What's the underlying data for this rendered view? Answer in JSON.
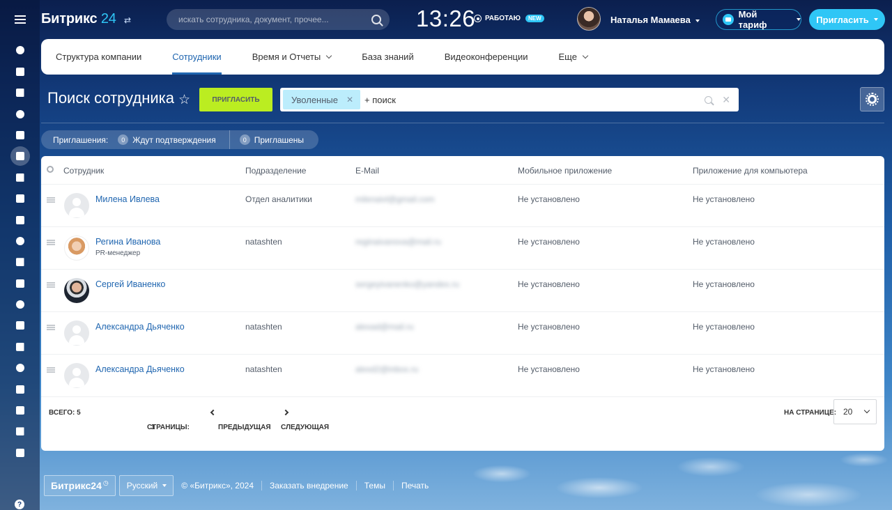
{
  "topbar": {
    "logo_main": "Битрикс",
    "logo_num": "24",
    "search_placeholder": "искать сотрудника, документ, прочее...",
    "time": "13:26",
    "work_status": "РАБОТАЮ",
    "new_badge": "NEW",
    "user_name": "Наталья Мамаева",
    "tariff_label": "Мой тариф",
    "invite_label": "Пригласить"
  },
  "nav": {
    "items": [
      {
        "label": "Структура компании"
      },
      {
        "label": "Сотрудники"
      },
      {
        "label": "Время и Отчеты"
      },
      {
        "label": "База знаний"
      },
      {
        "label": "Видеоконференции"
      },
      {
        "label": "Еще"
      }
    ]
  },
  "page": {
    "title": "Поиск сотрудника",
    "invite_button": "ПРИГЛАСИТЬ",
    "filter_chip": "Уволенные",
    "filter_add": "+ поиск"
  },
  "invitations": {
    "label": "Приглашения:",
    "pending_count": "0",
    "pending_label": "Ждут подтверждения",
    "invited_count": "0",
    "invited_label": "Приглашены"
  },
  "grid": {
    "columns": [
      "Сотрудник",
      "Подразделение",
      "E-Mail",
      "Мобильное приложение",
      "Приложение для компьютера"
    ],
    "rows": [
      {
        "name": "Милена Ивлева",
        "position": "",
        "department": "Отдел аналитики",
        "email": "milenaivl@gmail.com",
        "mobile": "Не установлено",
        "desktop": "Не установлено",
        "avatar": "blank"
      },
      {
        "name": "Регина Иванова",
        "position": "PR-менеджер",
        "department": "natashten",
        "email": "reginaivanova@mail.ru",
        "mobile": "Не установлено",
        "desktop": "Не установлено",
        "avatar": "photo1"
      },
      {
        "name": "Сергей Иваненко",
        "position": "",
        "department": "",
        "email": "sergeyivanenko@yandex.ru",
        "mobile": "Не установлено",
        "desktop": "Не установлено",
        "avatar": "photo2"
      },
      {
        "name": "Александра Дьяченко",
        "position": "",
        "department": "natashten",
        "email": "alexad@mail.ru",
        "mobile": "Не установлено",
        "desktop": "Не установлено",
        "avatar": "blank"
      },
      {
        "name": "Александра Дьяченко",
        "position": "",
        "department": "natashten",
        "email": "alexd2@inbox.ru",
        "mobile": "Не установлено",
        "desktop": "Не установлено",
        "avatar": "blank"
      }
    ],
    "total_label": "ВСЕГО: 5",
    "pages_label": "СТРАНИЦЫ:",
    "pages_value": "1",
    "prev_label": "ПРЕДЫДУЩАЯ",
    "next_label": "СЛЕДУЮЩАЯ",
    "per_page_label": "НА СТРАНИЦЕ:",
    "per_page_value": "20"
  },
  "footer": {
    "logo": "Битрикс24",
    "language": "Русский",
    "links": [
      "© «Битрикс», 2024",
      "Заказать внедрение",
      "Темы",
      "Печать"
    ]
  },
  "sidebar": {
    "icons": [
      "activity-icon",
      "feed-icon",
      "mail-icon",
      "calendar-icon",
      "document-icon",
      "contacts-icon",
      "chat-icon",
      "drive-icon",
      "team-icon",
      "tasks-icon",
      "checklist-icon",
      "filter-icon",
      "building-icon",
      "cart-icon",
      "sign-icon",
      "robot-icon",
      "box-icon",
      "c-icon",
      "analytics-icon",
      "check-circle-icon"
    ],
    "help": "?"
  },
  "colors": {
    "accent": "#2fc6f6",
    "link": "#2066b0",
    "invite_green": "#bbed21",
    "chip": "#bcedfc"
  }
}
